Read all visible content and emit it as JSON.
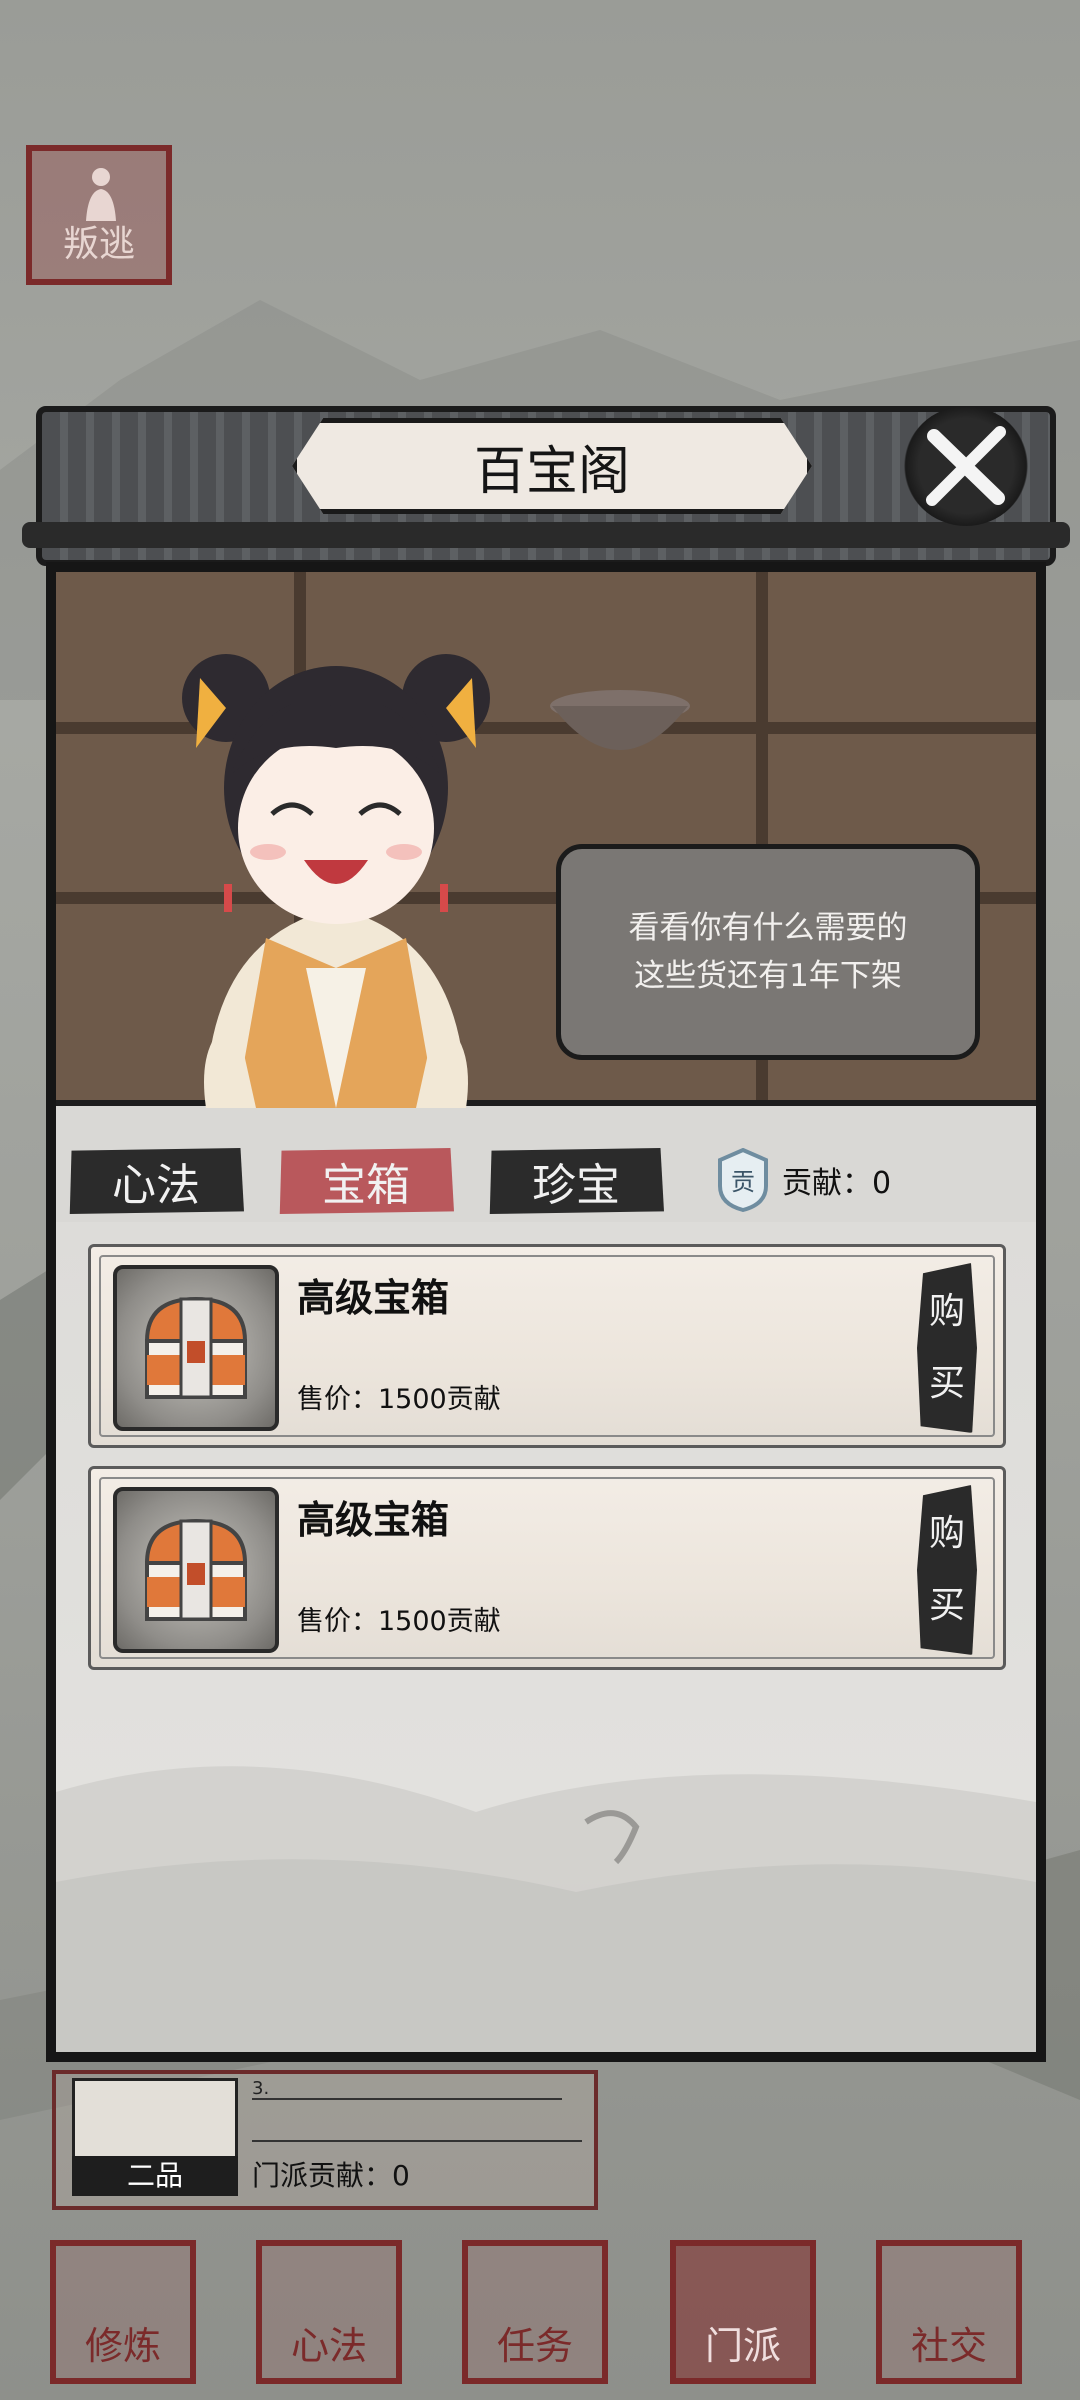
{
  "flee_button": {
    "label": "叛逃"
  },
  "modal": {
    "title": "百宝阁",
    "npc_dialogue": [
      "看看你有什么需要的",
      "这些货还有1年下架"
    ],
    "tabs": [
      {
        "label": "心法",
        "active": false
      },
      {
        "label": "宝箱",
        "active": true
      },
      {
        "label": "珍宝",
        "active": false
      }
    ],
    "contribution": {
      "badge_text": "贡",
      "label": "贡献：0"
    },
    "items": [
      {
        "name": "高级宝箱",
        "price": "售价：1500贡献",
        "buy_label_1": "购",
        "buy_label_2": "买"
      },
      {
        "name": "高级宝箱",
        "price": "售价：1500贡献",
        "buy_label_1": "购",
        "buy_label_2": "买"
      }
    ]
  },
  "sect_panel": {
    "grade": "二品",
    "line": "3.",
    "contribution": "门派贡献：0"
  },
  "bottom_nav": [
    {
      "label": "修炼",
      "active": false
    },
    {
      "label": "心法",
      "active": false
    },
    {
      "label": "任务",
      "active": false
    },
    {
      "label": "门派",
      "active": true
    },
    {
      "label": "社交",
      "active": false
    }
  ],
  "colors": {
    "accent_red": "#7b2a2a",
    "active_tab": "#b9585c",
    "ink": "#161616"
  }
}
